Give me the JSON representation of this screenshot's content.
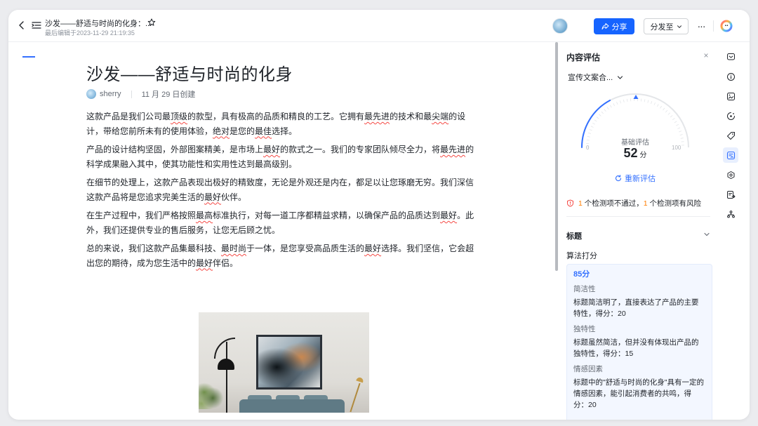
{
  "header": {
    "title": "沙发——舒适与时尚的化身：...",
    "subtitle": "最后编辑于2023-11-29 21:19:35",
    "share_label": "分享",
    "distribute_label": "分发至",
    "more_label": "···"
  },
  "doc": {
    "title": "沙发——舒适与时尚的化身",
    "author": "sherry",
    "created": "11 月 29 日创建",
    "paragraphs": [
      [
        {
          "t": "这款产品是我们公司最",
          "flag": false
        },
        {
          "t": "顶级",
          "flag": true
        },
        {
          "t": "的款型，具有极高的品质和精良的工艺。它拥有",
          "flag": false
        },
        {
          "t": "最先进",
          "flag": true
        },
        {
          "t": "的技术和最",
          "flag": false
        },
        {
          "t": "尖端",
          "flag": true
        },
        {
          "t": "的设计，带给您前所未有的使用体验，",
          "flag": false
        },
        {
          "t": "绝对",
          "flag": true
        },
        {
          "t": "是您的",
          "flag": false
        },
        {
          "t": "最佳",
          "flag": true
        },
        {
          "t": "选择。",
          "flag": false
        }
      ],
      [
        {
          "t": "产品的设计结构坚固，外部图案精美，是市场上",
          "flag": false
        },
        {
          "t": "最好",
          "flag": true
        },
        {
          "t": "的款式之一。我们的专家团队倾尽全力，将",
          "flag": false
        },
        {
          "t": "最先进",
          "flag": true
        },
        {
          "t": "的科学成果融入其中，使其功能性和实用性达到最高级别。",
          "flag": false
        }
      ],
      [
        {
          "t": "在细节的处理上，这款产品表现出极好的精致度，无论是外观还是内在，都足以让您琢磨无穷。我们深信这款产品将是您追求完美生活的",
          "flag": false
        },
        {
          "t": "最好",
          "flag": true
        },
        {
          "t": "伙伴。",
          "flag": false
        }
      ],
      [
        {
          "t": "在生产过程中，我们严格按照",
          "flag": false
        },
        {
          "t": "最高",
          "flag": true
        },
        {
          "t": "标准执行，对每一道工序都精益求精，以确保产品的品质达到",
          "flag": false
        },
        {
          "t": "最好",
          "flag": true
        },
        {
          "t": "。此外，我们还提供专业的售后服务，让您无后顾之忧。",
          "flag": false
        }
      ],
      [
        {
          "t": "总的来说，我们这款产品集最科技、",
          "flag": false
        },
        {
          "t": "最时尚",
          "flag": true
        },
        {
          "t": "于一体，是您享受高品质生活的",
          "flag": false
        },
        {
          "t": "最好",
          "flag": true
        },
        {
          "t": "选择。我们坚信，它会超出您的期待，成为您生活中的",
          "flag": false
        },
        {
          "t": "最好",
          "flag": true
        },
        {
          "t": "伴侣。",
          "flag": false
        }
      ]
    ]
  },
  "panel": {
    "title": "内容评估",
    "close_label": "×",
    "select_value": "宣传文案合...",
    "gauge": {
      "label": "基础评估",
      "value": 52,
      "unit": "分",
      "min_label": "0",
      "max_label": "100",
      "max": 100
    },
    "reevaluate_label": "重新评估",
    "warning": {
      "fail_count": "1",
      "fail_text": " 个检测项不通过，",
      "risk_count": "1",
      "risk_text": " 个检测项有风险"
    },
    "section_title": "标题",
    "algo_label": "算法打分",
    "card": {
      "score": "85分",
      "criteria": [
        {
          "name": "简洁性",
          "desc": "标题简洁明了，直接表达了产品的主要特性，得分：20"
        },
        {
          "name": "独特性",
          "desc": "标题虽然简洁，但并没有体现出产品的独特性，得分：15"
        },
        {
          "name": "情感因素",
          "desc": "标题中的\"舒适与时尚的化身\"具有一定的情感因素，能引起消费者的共鸣，得分：20"
        }
      ]
    }
  },
  "rail_icons": [
    "comment-icon",
    "info-icon",
    "image-icon",
    "palette-icon",
    "tag-icon",
    "evaluate-icon",
    "plugin-icon",
    "export-icon",
    "analytics-icon"
  ],
  "rail_active": "evaluate-icon",
  "colors": {
    "accent": "#3370ff",
    "share_button": "#1664ff",
    "flag_underline": "#f54a45",
    "warning_count": "#ff7d00",
    "gauge_track": "#e4e6e9"
  }
}
